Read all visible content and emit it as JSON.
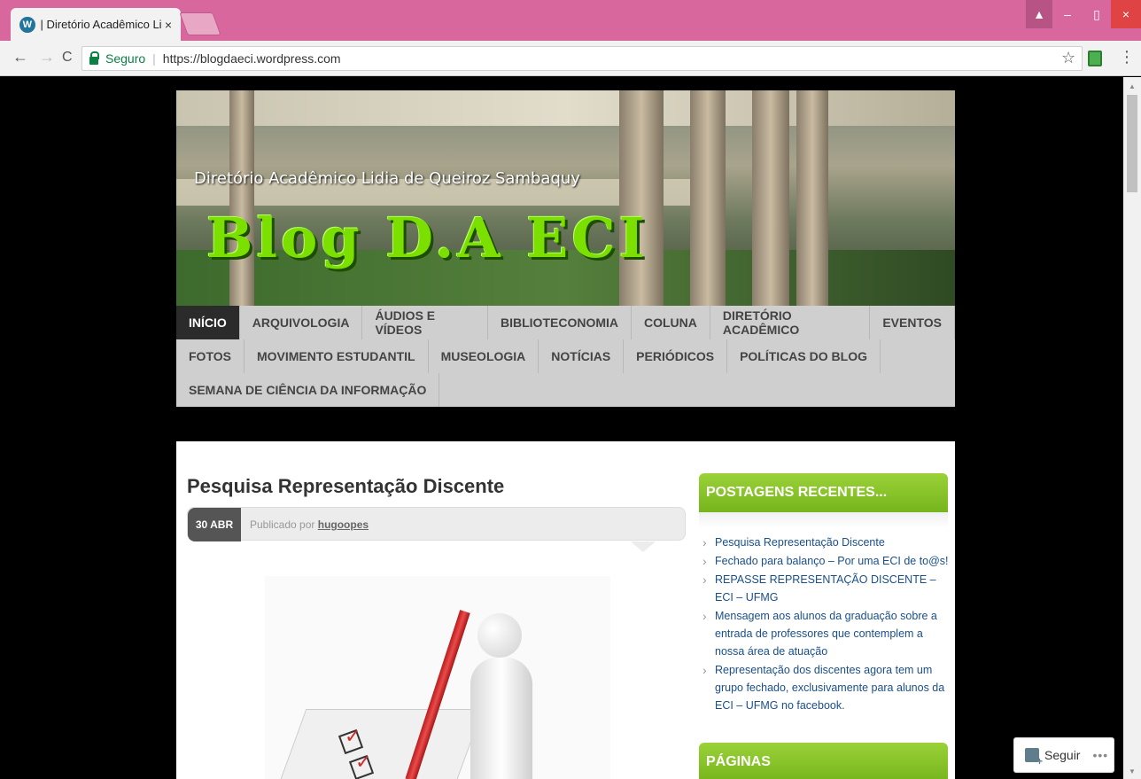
{
  "browser": {
    "tab_title": "| Diretório Acadêmico Lic",
    "tab_close": "×",
    "secure_label": "Seguro",
    "separator": "|",
    "url": "https://blogdaeci.wordpress.com",
    "back": "←",
    "forward": "→",
    "reload": "C",
    "star": "☆",
    "menu": "⋮",
    "win_user": "▲",
    "win_min": "–",
    "win_max": "▯",
    "win_close": "×"
  },
  "header": {
    "subtitle": "Diretório Acadêmico Lidia de Queiroz Sambaquy",
    "title": "Blog D.A ECI"
  },
  "nav": {
    "row1": [
      "INÍCIO",
      "ARQUIVOLOGIA",
      "ÁUDIOS E VÍDEOS",
      "BIBLIOTECONOMIA",
      "COLUNA",
      "DIRETÓRIO ACADÊMICO",
      "EVENTOS"
    ],
    "row2": [
      "FOTOS",
      "MOVIMENTO ESTUDANTIL",
      "MUSEOLOGIA",
      "NOTÍCIAS",
      "PERIÓDICOS",
      "POLÍTICAS DO BLOG"
    ],
    "row3": [
      "SEMANA DE CIÊNCIA DA INFORMAÇÃO"
    ]
  },
  "post": {
    "title": "Pesquisa Representação Discente",
    "date": "30 ABR",
    "published_by": "Publicado por",
    "author": "hugoopes"
  },
  "sidebar": {
    "recent_title": "POSTAGENS RECENTES...",
    "recent_posts": [
      "Pesquisa Representação Discente",
      "Fechado para balanço – Por uma ECI de to@s!",
      "REPASSE REPRESENTAÇÃO DISCENTE – ECI – UFMG",
      "Mensagem aos alunos da graduação sobre a entrada de professores que contemplem a nossa área de atuação",
      "Representação dos discentes agora tem um grupo fechado, exclusivamente para alunos da ECI – UFMG no facebook."
    ],
    "pages_title": "PÁGINAS"
  },
  "follow": {
    "label": "Seguir",
    "more": "•••"
  },
  "colors": {
    "titlebar": "#d8679e",
    "accent_green": "#8cc63f",
    "link": "#1a4f8a"
  }
}
